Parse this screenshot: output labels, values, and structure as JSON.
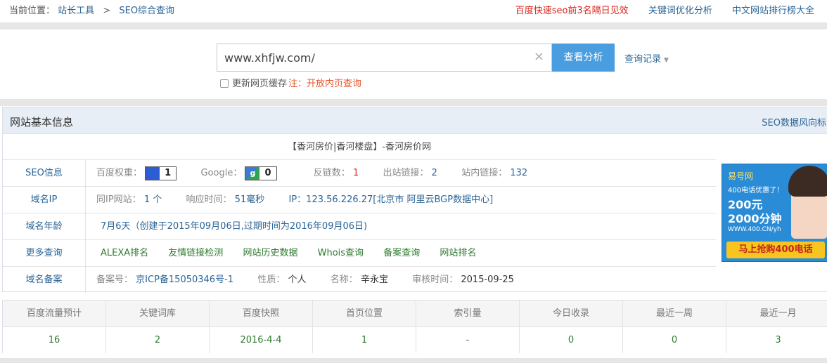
{
  "breadcrumb": {
    "prefix": "当前位置：",
    "sep": ">",
    "item1": "站长工具",
    "item2": "SEO综合查询"
  },
  "top_links": {
    "ad": "百度快速seo前3名隔日见效",
    "keyword": "关键词优化分析",
    "ranking": "中文网站排行榜大全"
  },
  "search": {
    "value": "www.xhfjw.com/",
    "clear_icon": "×",
    "button": "查看分析",
    "history": "查询记录",
    "history_caret": "▼"
  },
  "refresh": {
    "label": "更新网页缓存",
    "note": "注：开放内页查询"
  },
  "panel": {
    "title": "网站基本信息",
    "right_link": "SEO数据风向标",
    "site_title": "【香河房价|香河楼盘】-香河房价网"
  },
  "seo": {
    "label": "SEO信息",
    "baidu_label": "百度权重：",
    "baidu_icon": "🐾",
    "baidu_value": "1",
    "google_label": "Google：",
    "google_icon": "g",
    "google_value": "0",
    "backlinks_label": "反链数：",
    "backlinks": "1",
    "outlinks_label": "出站链接：",
    "outlinks": "2",
    "inlinks_label": "站内链接：",
    "inlinks": "132"
  },
  "ip": {
    "label": "域名IP",
    "same_ip_label": "同IP网站：",
    "same_ip": "1 个",
    "resp_label": "响应时间：",
    "resp": "51毫秒",
    "ip": "IP：123.56.226.27[北京市 阿里云BGP数据中心]"
  },
  "age": {
    "label": "域名年龄",
    "value": "7月6天（创建于2015年09月06日,过期时间为2016年09月06日)"
  },
  "more": {
    "label": "更多查询",
    "links": [
      "ALEXA排名",
      "友情链接检测",
      "网站历史数据",
      "Whois查询",
      "备案查询",
      "网站排名"
    ]
  },
  "icp": {
    "label": "域名备案",
    "no_label": "备案号：",
    "no": "京ICP备15050346号-1",
    "type_label": "性质：",
    "type": "个人",
    "name_label": "名称：",
    "name": "辛永宝",
    "date_label": "审核时间：",
    "date": "2015-09-25"
  },
  "ad": {
    "brand": "易号网",
    "slogan": "400电话优惠了！",
    "price": "200元",
    "minutes": "2000分钟",
    "url": "WWW.400.CN/yh",
    "cta": "马上抢购400电话"
  },
  "stats": {
    "headers": [
      "百度流量预计",
      "关键词库",
      "百度快照",
      "首页位置",
      "索引量",
      "今日收录",
      "最近一周",
      "最近一月"
    ],
    "values": [
      "16",
      "2",
      "2016-4-4",
      "1",
      "-",
      "0",
      "0",
      "3"
    ]
  }
}
